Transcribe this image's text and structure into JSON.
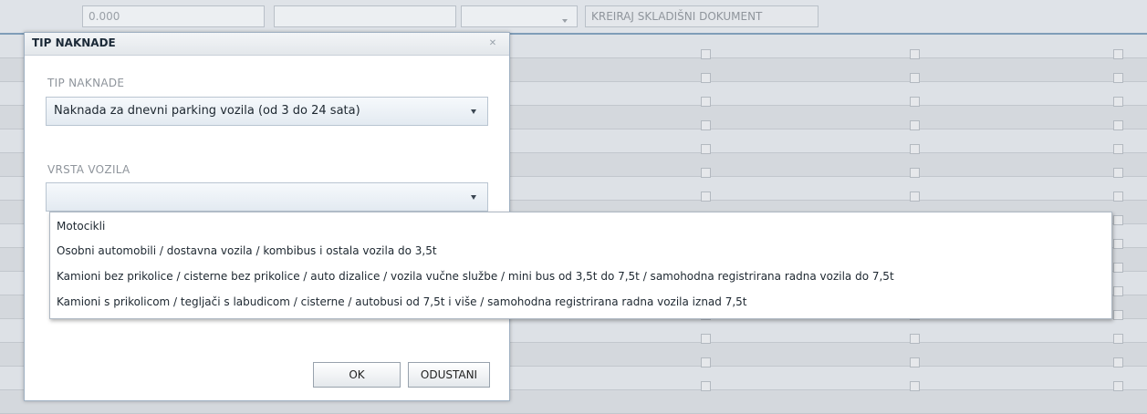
{
  "background": {
    "amount_value": "0.000",
    "create_doc_label": "KREIRAJ SKLADIŠNI DOKUMENT"
  },
  "dialog": {
    "title": "TIP NAKNADE",
    "close_icon": "close-icon",
    "fee_type_label": "TIP NAKNADE",
    "fee_type_value": "Naknada za dnevni parking vozila (od 3 do 24 sata)",
    "vehicle_type_label": "VRSTA VOZILA",
    "vehicle_type_value": "",
    "ok_label": "OK",
    "cancel_label": "ODUSTANI"
  },
  "dropdown": {
    "items": [
      "Motocikli",
      "Osobni automobili / dostavna vozila / kombibus i ostala vozila do 3,5t",
      "Kamioni bez prikolice / cisterne bez prikolice / auto dizalice / vozila vučne službe / mini bus od 3,5t do 7,5t / samohodna registrirana radna vozila do 7,5t",
      "Kamioni s prikolicom / tegljači s labudicom / cisterne / autobusi od 7,5t i više / samohodna registrirana radna vozila iznad 7,5t"
    ]
  },
  "colors": {
    "accent_border": "#7f9db8",
    "dialog_bg": "#ffffff",
    "muted_label": "#8f959c"
  }
}
